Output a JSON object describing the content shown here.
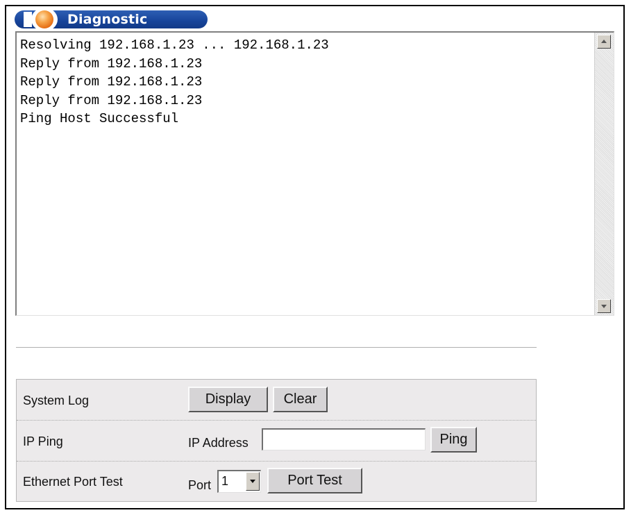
{
  "panel": {
    "title": "Diagnostic"
  },
  "output": {
    "lines": "Resolving 192.168.1.23 ... 192.168.1.23\nReply from 192.168.1.23\nReply from 192.168.1.23\nReply from 192.168.1.23\nPing Host Successful"
  },
  "system_log": {
    "label": "System Log",
    "display_label": "Display",
    "clear_label": "Clear"
  },
  "ip_ping": {
    "label": "IP Ping",
    "address_label": "IP Address",
    "address_value": "",
    "ping_label": "Ping"
  },
  "port_test": {
    "label": "Ethernet Port Test",
    "port_label": "Port",
    "port_value": "1",
    "button_label": "Port Test"
  }
}
